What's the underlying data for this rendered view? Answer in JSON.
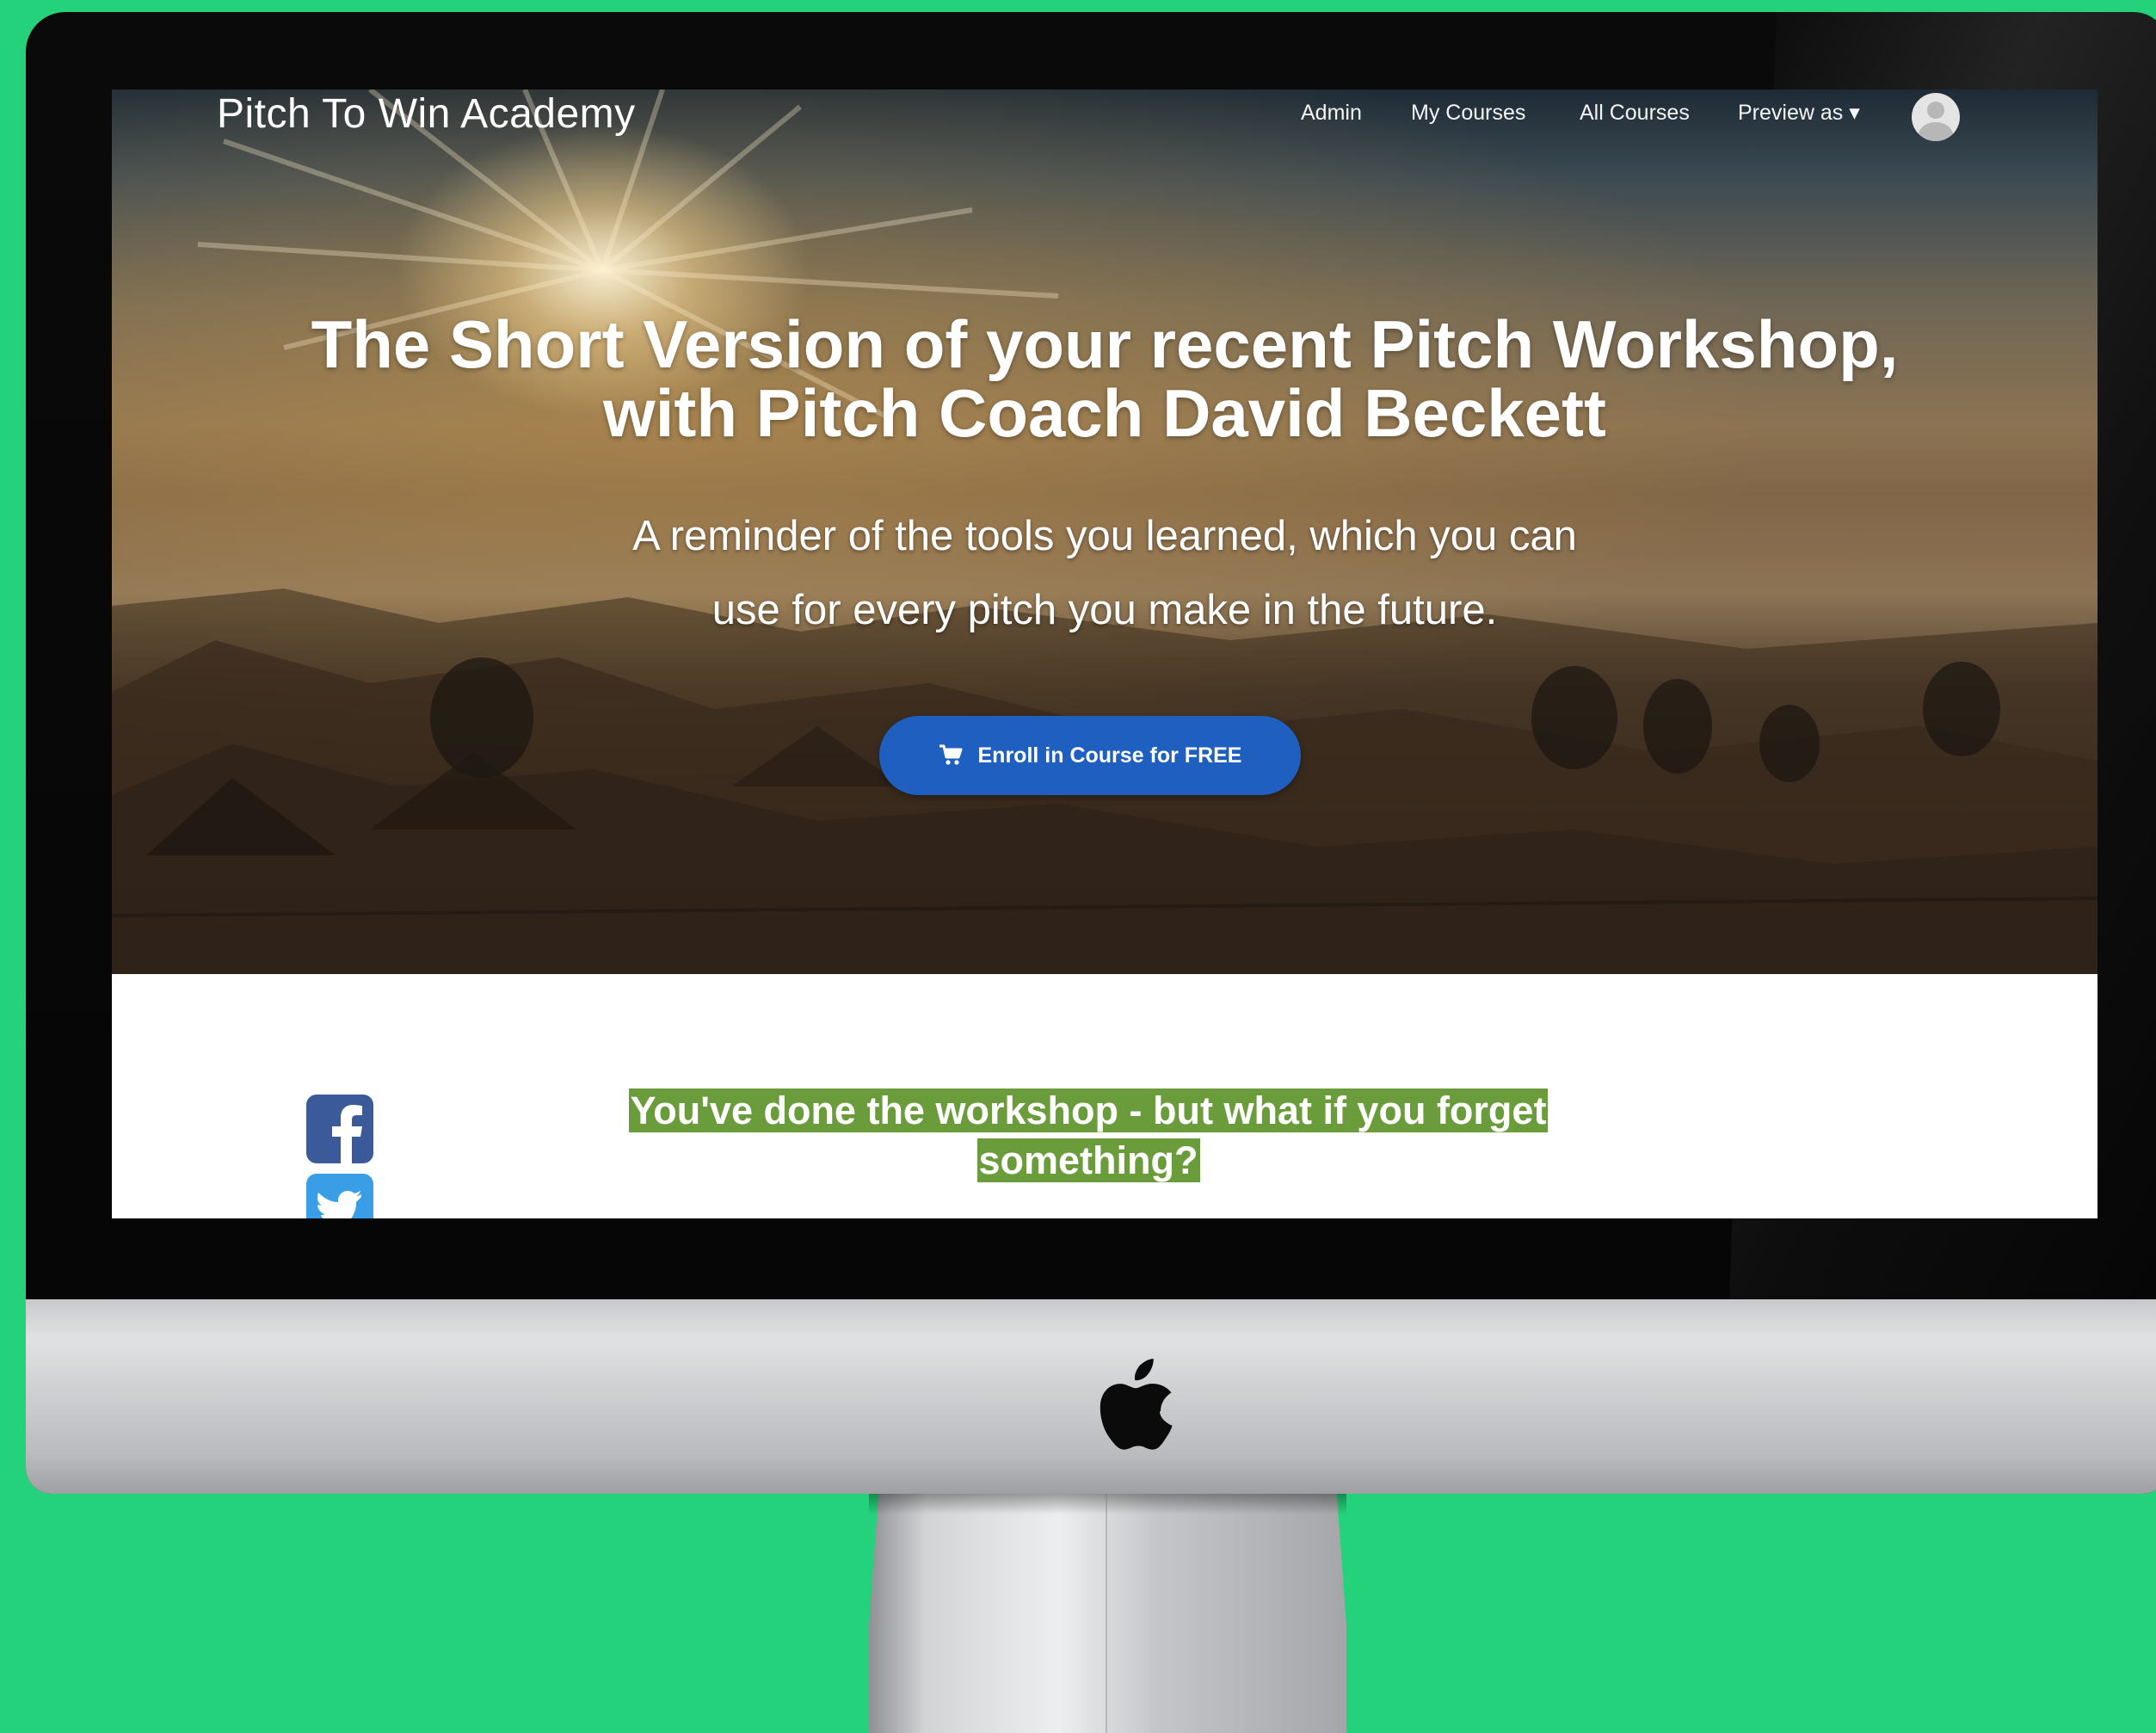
{
  "navbar": {
    "brand": "Pitch To Win Academy",
    "links": [
      "Admin",
      "My Courses",
      "All Courses",
      "Preview as ▾"
    ],
    "avatar_icon": "user-avatar-icon"
  },
  "hero": {
    "title_line1": "The Short Version of your recent Pitch Workshop,",
    "title_line2": "with Pitch Coach David Beckett",
    "subtitle_line1": "A reminder of the tools you learned, which you can",
    "subtitle_line2": "use for every pitch you make in the future.",
    "enroll_button": "Enroll in Course for FREE",
    "button_color": "#1f5fc0"
  },
  "content": {
    "heading_line1": "You've done the workshop - but what if you forget",
    "heading_line2": "something?",
    "highlight_color": "#6b9c3c",
    "share_icons": [
      "facebook-icon",
      "twitter-icon"
    ]
  },
  "device": {
    "background_color": "#23d27a",
    "logo_icon": "apple-logo-icon"
  }
}
